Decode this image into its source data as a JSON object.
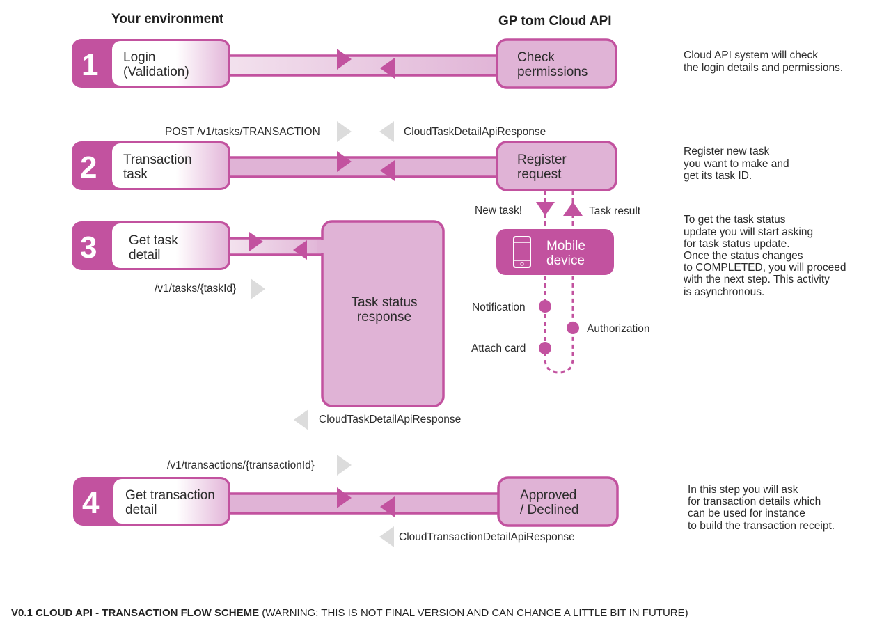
{
  "colors": {
    "magenta": "#c2529f",
    "light_pink": "#e0b3d6",
    "pipe_fill": "#ead0e4",
    "hint_arrow": "#dcdcdc",
    "text": "#2b2b2b"
  },
  "headers": {
    "left": "Your environment",
    "right": "GP tom Cloud API"
  },
  "steps": [
    {
      "number": "1",
      "client_label": [
        "Login",
        "(Validation)"
      ],
      "server_label": [
        "Check",
        "permissions"
      ],
      "description": [
        "Cloud API system will check",
        "the login details and permissions."
      ]
    },
    {
      "number": "2",
      "request": "POST /v1/tasks/TRANSACTION",
      "response": "CloudTaskDetailApiResponse",
      "client_label": [
        "Transaction",
        "task"
      ],
      "server_label": [
        "Register",
        "request"
      ],
      "description": [
        "Register new task",
        "you want to make and",
        "get its task ID."
      ]
    },
    {
      "number": "3",
      "request": "/v1/tasks/{taskId}",
      "response": "CloudTaskDetailApiResponse",
      "client_label": [
        "Get task",
        "detail"
      ],
      "server_label": [
        "Task status",
        "response"
      ],
      "description": [
        "To get the task status",
        "update you will start asking",
        "for task status update.",
        "Once the status changes",
        "to COMPLETED, you will proceed",
        "with the next step. This activity",
        "is asynchronous."
      ]
    },
    {
      "number": "4",
      "request": "/v1/transactions/{transactionId}",
      "response": "CloudTransactionDetailApiResponse",
      "client_label": [
        "Get transaction",
        "detail"
      ],
      "server_label": [
        "Approved",
        "/ Declined"
      ],
      "description": [
        "In this step you will ask",
        "for transaction details which",
        "can be used for instance",
        "to build the transaction receipt."
      ]
    }
  ],
  "mobile": {
    "label": [
      "Mobile",
      "device"
    ],
    "icon": "smartphone-icon",
    "down_label": "New task!",
    "up_label": "Task result",
    "events": {
      "notification": "Notification",
      "attach_card": "Attach card",
      "authorization": "Authorization"
    }
  },
  "footer": {
    "bold": "V0.1 CLOUD API - TRANSACTION FLOW SCHEME",
    "normal": " (WARNING: THIS IS NOT FINAL VERSION AND CAN CHANGE A LITTLE BIT IN FUTURE)"
  }
}
